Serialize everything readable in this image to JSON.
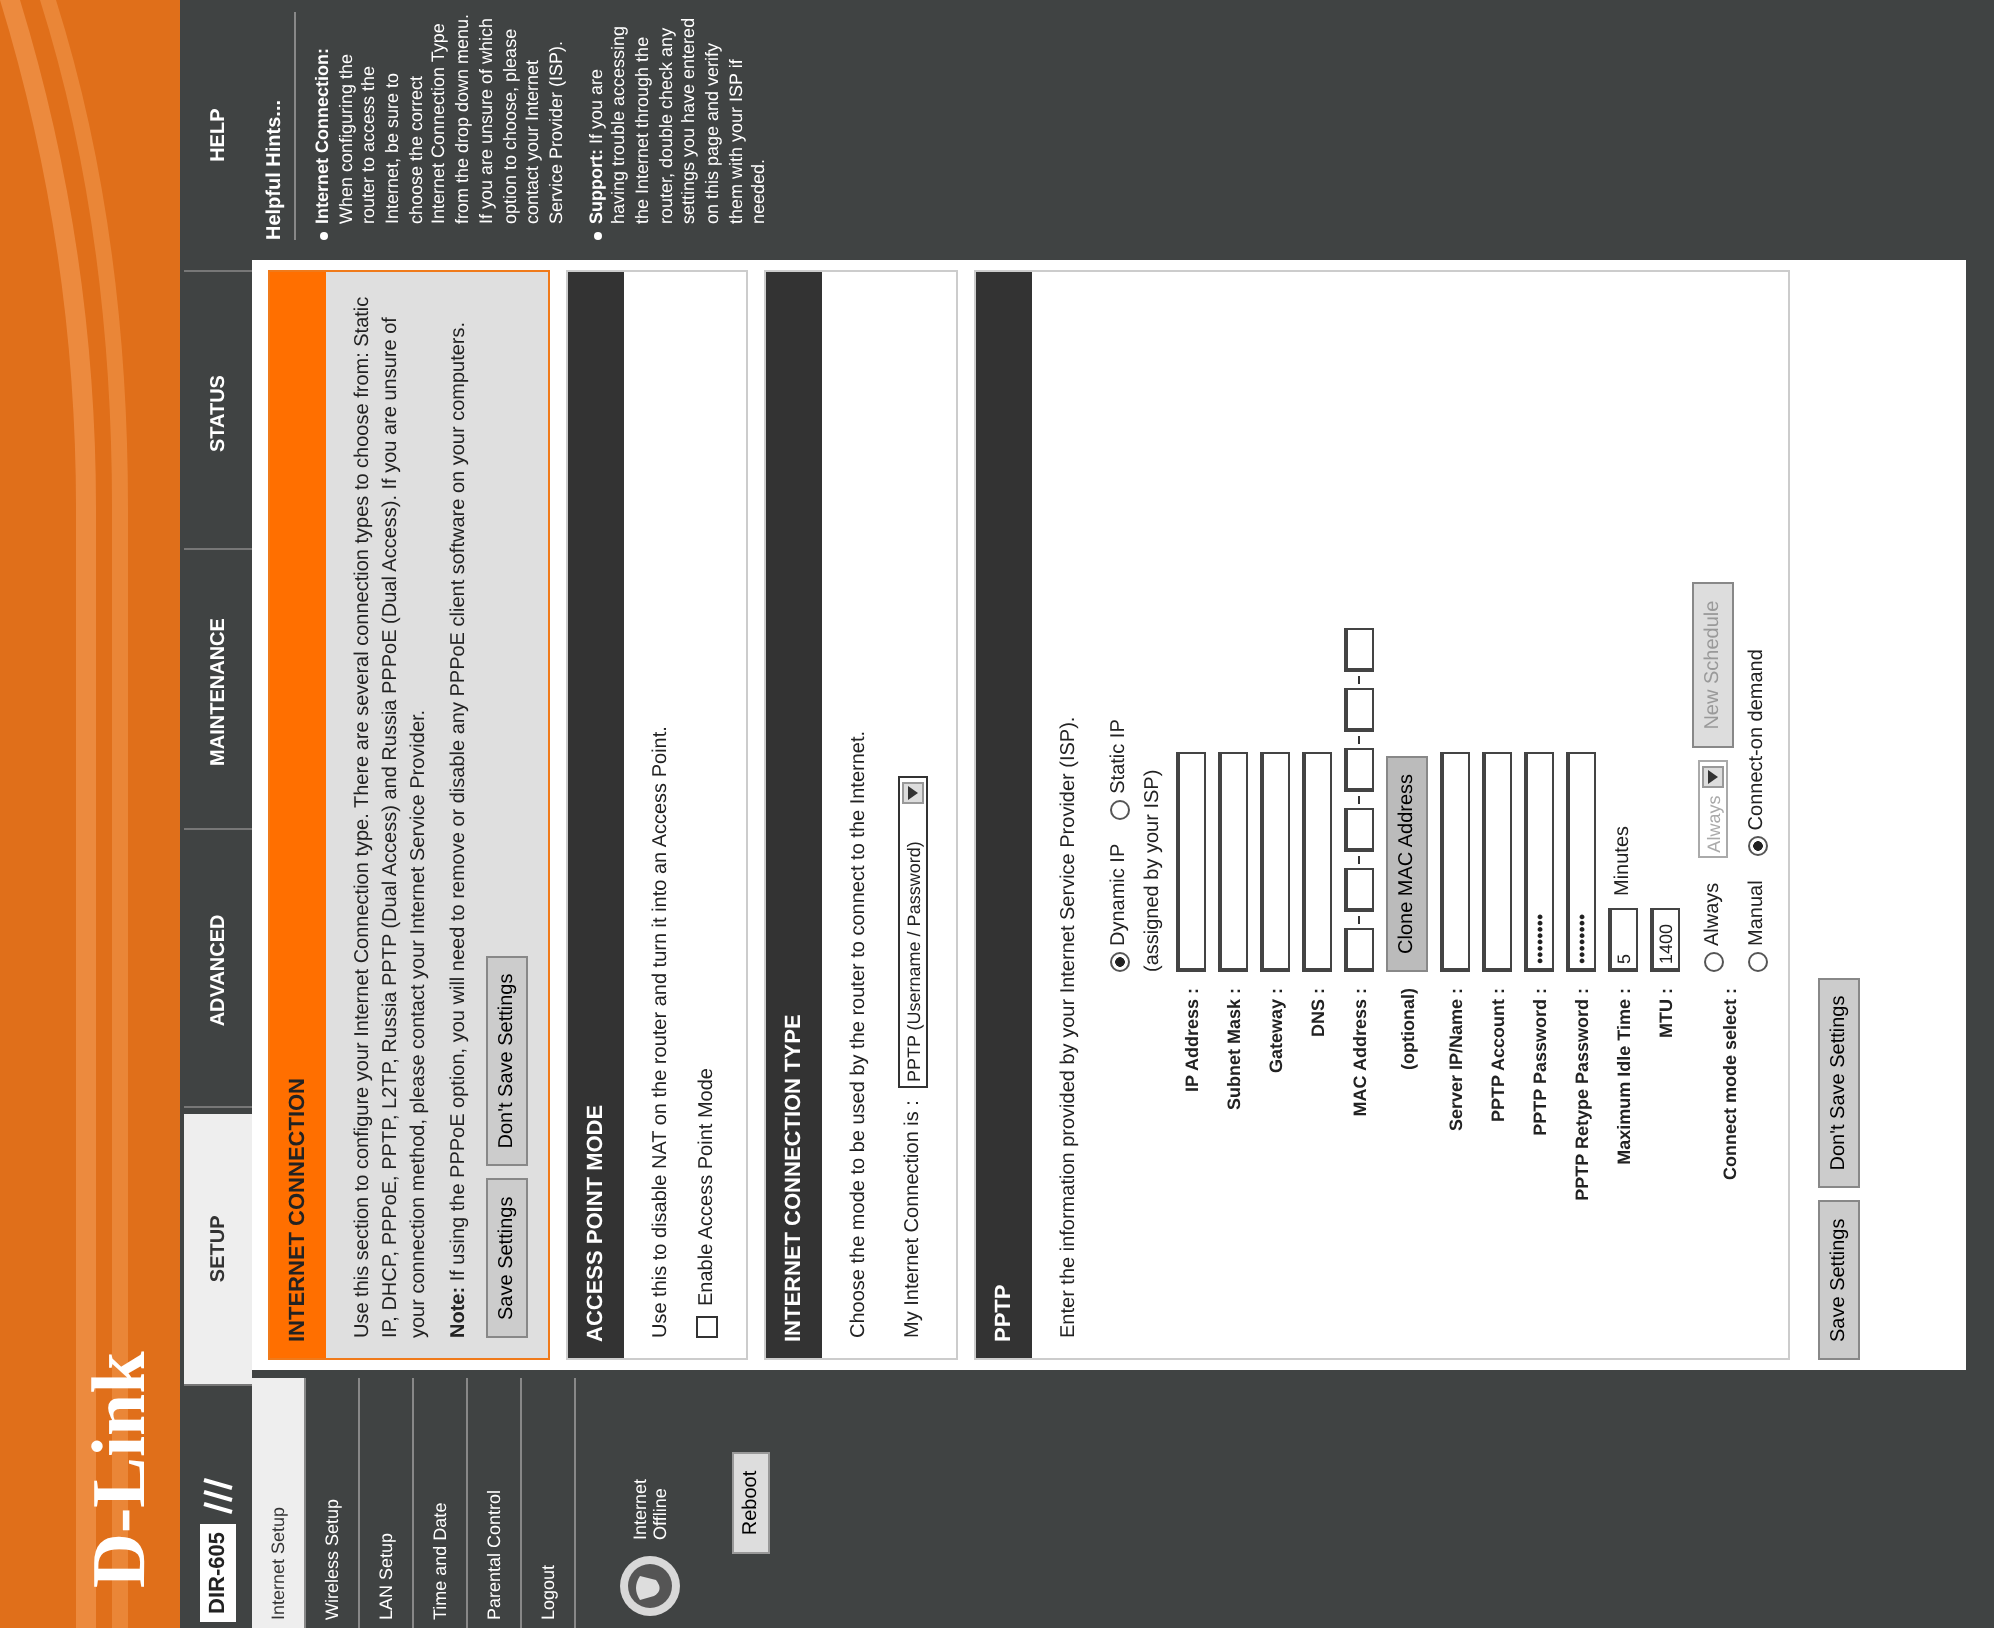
{
  "logo": "D-Link",
  "model": "DIR-605",
  "tabs": [
    {
      "label": "SETUP",
      "selected": true
    },
    {
      "label": "ADVANCED",
      "selected": false
    },
    {
      "label": "MAINTENANCE",
      "selected": false
    },
    {
      "label": "STATUS",
      "selected": false
    },
    {
      "label": "HELP",
      "selected": false
    }
  ],
  "sidebar": {
    "items": [
      {
        "label": "Internet Setup",
        "selected": true
      },
      {
        "label": "Wireless Setup",
        "selected": false
      },
      {
        "label": "LAN Setup",
        "selected": false
      },
      {
        "label": "Time and Date",
        "selected": false
      },
      {
        "label": "Parental Control",
        "selected": false
      },
      {
        "label": "Logout",
        "selected": false
      }
    ],
    "status": "Internet Offline",
    "reboot": "Reboot"
  },
  "sections": [
    {
      "kind": "intro",
      "title": "INTERNET CONNECTION",
      "paragraphs": [
        "Use this section to configure your Internet Connection type. There are several connection types to choose from: Static IP, DHCP, PPPoE, PPTP, L2TP, Russia PPTP (Dual Access) and Russia PPPoE (Dual Access). If you are unsure of your connection method, please contact your Internet Service Provider.",
        "**Note:** If using the PPPoE option, you will need to remove or disable any PPPoE client software on your computers."
      ],
      "buttons": [
        "Save Settings",
        "Don't Save Settings"
      ]
    },
    {
      "kind": "apmode",
      "title": "ACCESS POINT MODE",
      "text": "Use this to disable NAT on the router and turn it into an Access Point.",
      "checkbox": {
        "label": "Enable Access Point Mode",
        "checked": false
      }
    },
    {
      "kind": "conntype",
      "title": "INTERNET CONNECTION TYPE",
      "text": "Choose the mode to be used by the router to connect to the Internet.",
      "field": {
        "label": "My Internet Connection is :",
        "value": "PPTP (Username / Password)"
      }
    },
    {
      "kind": "form",
      "title": "PPTP",
      "text": "Enter the information provided by your Internet Service Provider (ISP).",
      "rows": [
        {
          "kind": "radio",
          "options": [
            {
              "label": "Dynamic IP",
              "selected": true
            },
            {
              "label": "Static IP",
              "selected": false
            }
          ]
        },
        {
          "kind": "note",
          "text": "(assigned by your ISP)"
        },
        {
          "kind": "text",
          "label": "IP Address :"
        },
        {
          "kind": "text",
          "label": "Subnet Mask :"
        },
        {
          "kind": "text",
          "label": "Gateway :"
        },
        {
          "kind": "text",
          "label": "DNS :"
        },
        {
          "kind": "mac",
          "label": "MAC Address :",
          "note": "(optional)",
          "button": "Clone MAC Address"
        },
        {
          "kind": "text",
          "label": "Server IP/Name :"
        },
        {
          "kind": "text",
          "label": "PPTP Account :"
        },
        {
          "kind": "text",
          "label": "PPTP Password :",
          "value": "••••••••"
        },
        {
          "kind": "text",
          "label": "PPTP Retype Password :",
          "value": "••••••••"
        },
        {
          "kind": "short",
          "label": "Maximum Idle Time :",
          "value": "5",
          "unit": "Minutes"
        },
        {
          "kind": "short",
          "label": "MTU :",
          "value": "1400"
        },
        {
          "kind": "connect",
          "label": "Connect mode select :",
          "options": [
            {
              "label": "Always",
              "selected": false
            },
            {
              "label": "Manual",
              "selected": false
            },
            {
              "label": "Connect-on demand",
              "selected": true
            }
          ],
          "schedule": {
            "value": "Always",
            "disabled": true
          },
          "button": {
            "label": "New Schedule",
            "disabled": true
          }
        }
      ]
    }
  ],
  "bottom_buttons": [
    "Save Settings",
    "Don't Save Settings"
  ],
  "help": {
    "title": "Helpful Hints...",
    "items": [
      {
        "heading": "Internet Connection:",
        "text": "When configuring the router to access the Internet, be sure to choose the correct Internet Connection Type from the drop down menu. If you are unsure of which option to choose, please contact your Internet Service Provider (ISP)."
      },
      {
        "heading": "Support:",
        "text": "If you are having trouble accessing the Internet through the router, double check any settings you have entered on this page and verify them with your ISP if needed."
      }
    ]
  }
}
